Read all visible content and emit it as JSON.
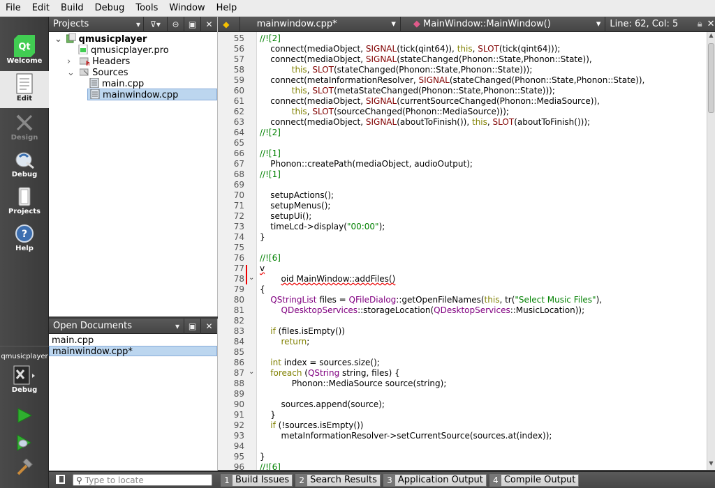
{
  "menubar": {
    "items": [
      {
        "label": "File"
      },
      {
        "label": "Edit"
      },
      {
        "label": "Build"
      },
      {
        "label": "Debug"
      },
      {
        "label": "Tools"
      },
      {
        "label": "Window"
      },
      {
        "label": "Help"
      }
    ]
  },
  "modes": {
    "welcome": "Welcome",
    "edit": "Edit",
    "design": "Design",
    "debug": "Debug",
    "projects": "Projects",
    "help": "Help",
    "project_name": "qmusicplayer",
    "target_mode": "Debug"
  },
  "projects_panel": {
    "title": "Projects",
    "tree": {
      "root": "qmusicplayer",
      "pro": "qmusicplayer.pro",
      "headers": "Headers",
      "sources": "Sources",
      "main": "main.cpp",
      "mainwindow": "mainwindow.cpp"
    }
  },
  "open_documents": {
    "title": "Open Documents",
    "files": [
      "main.cpp",
      "mainwindow.cpp*"
    ]
  },
  "editor_header": {
    "file": "mainwindow.cpp*",
    "symbol": "MainWindow::MainWindow()",
    "position": "Line: 62, Col: 5"
  },
  "code": {
    "line_numbers": [
      "55",
      "56",
      "57",
      "58",
      "59",
      "60",
      "61",
      "62",
      "63",
      "64",
      "65",
      "66",
      "67",
      "68",
      "69",
      "70",
      "71",
      "72",
      "73",
      "74",
      "75",
      "76",
      "77",
      "78",
      "79",
      "80",
      "81",
      "82",
      "83",
      "84",
      "85",
      "86",
      "87",
      "88",
      "89",
      "90",
      "91",
      "92",
      "93",
      "94",
      "95",
      "96"
    ]
  },
  "statusbar": {
    "locate_placeholder": "Type to locate",
    "tabs": [
      {
        "num": "1",
        "label": "Build Issues"
      },
      {
        "num": "2",
        "label": "Search Results"
      },
      {
        "num": "3",
        "label": "Application Output"
      },
      {
        "num": "4",
        "label": "Compile Output"
      }
    ]
  }
}
